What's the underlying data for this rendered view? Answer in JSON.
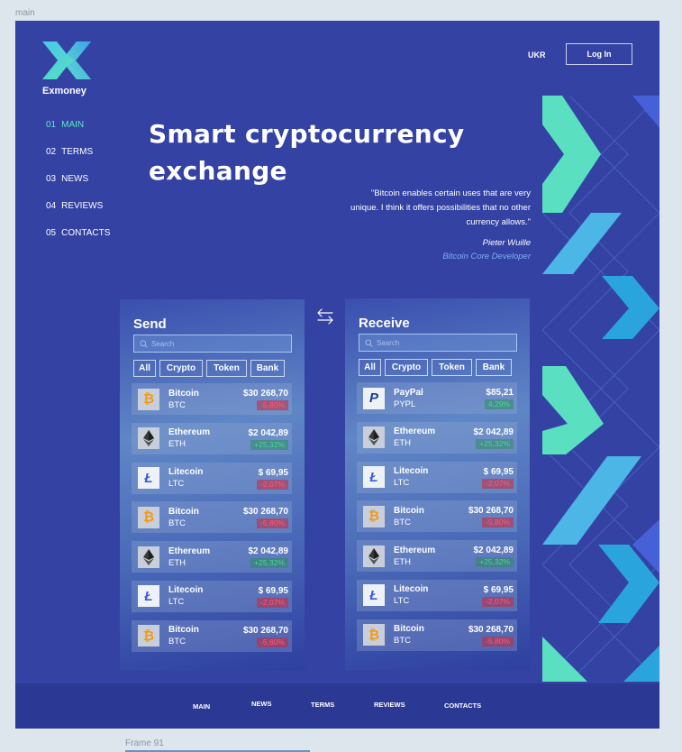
{
  "canvas": {
    "frame_label": "main",
    "next_frame_label": "Frame 91"
  },
  "brand": {
    "name": "Exmoney"
  },
  "header": {
    "lang": "UKR",
    "login_label": "Log In"
  },
  "nav": [
    {
      "num": "01",
      "label": "MAIN"
    },
    {
      "num": "02",
      "label": "TERMS"
    },
    {
      "num": "03",
      "label": "NEWS"
    },
    {
      "num": "04",
      "label": "REVIEWS"
    },
    {
      "num": "05",
      "label": "CONTACTS"
    }
  ],
  "hero": {
    "title_line1": "Smart cryptocurrency",
    "title_line2": "exchange",
    "quote_line1": "\"Bitcoin enables certain uses that are very",
    "quote_line2": "unique. I think it offers possibilities that no other",
    "quote_line3": "currency allows.\"",
    "author": "Pieter Wuille",
    "role": "Bitcoin Core Developer"
  },
  "send": {
    "title": "Send",
    "search_placeholder": "Search",
    "filters": [
      "All",
      "Crypto",
      "Token",
      "Bank"
    ],
    "rows": [
      {
        "name": "Bitcoin",
        "symbol": "BTC",
        "price": "$30 268,70",
        "change": "-5,80%",
        "dir": "neg",
        "icon": "btc"
      },
      {
        "name": "Ethereum",
        "symbol": "ETH",
        "price": "$2 042,89",
        "change": "+25,32%",
        "dir": "pos",
        "icon": "eth"
      },
      {
        "name": "Litecoin",
        "symbol": "LTC",
        "price": "$ 69,95",
        "change": "-2,07%",
        "dir": "neg",
        "icon": "ltc"
      },
      {
        "name": "Bitcoin",
        "symbol": "BTC",
        "price": "$30 268,70",
        "change": "-5,80%",
        "dir": "neg",
        "icon": "btc"
      },
      {
        "name": "Ethereum",
        "symbol": "ETH",
        "price": "$2 042,89",
        "change": "+25,32%",
        "dir": "pos",
        "icon": "eth"
      },
      {
        "name": "Litecoin",
        "symbol": "LTC",
        "price": "$ 69,95",
        "change": "-2,07%",
        "dir": "neg",
        "icon": "ltc"
      },
      {
        "name": "Bitcoin",
        "symbol": "BTC",
        "price": "$30 268,70",
        "change": "-5,80%",
        "dir": "neg",
        "icon": "btc"
      }
    ]
  },
  "receive": {
    "title": "Receive",
    "search_placeholder": "Search",
    "filters": [
      "All",
      "Crypto",
      "Token",
      "Bank"
    ],
    "rows": [
      {
        "name": "PayPal",
        "symbol": "PYPL",
        "price": "$85,21",
        "change": "4,29%",
        "dir": "pos",
        "icon": "pp"
      },
      {
        "name": "Ethereum",
        "symbol": "ETH",
        "price": "$2 042,89",
        "change": "+25,32%",
        "dir": "pos",
        "icon": "eth"
      },
      {
        "name": "Litecoin",
        "symbol": "LTC",
        "price": "$ 69,95",
        "change": "-2,07%",
        "dir": "neg",
        "icon": "ltc"
      },
      {
        "name": "Bitcoin",
        "symbol": "BTC",
        "price": "$30 268,70",
        "change": "-5,80%",
        "dir": "neg",
        "icon": "btc"
      },
      {
        "name": "Ethereum",
        "symbol": "ETH",
        "price": "$2 042,89",
        "change": "+25,32%",
        "dir": "pos",
        "icon": "eth"
      },
      {
        "name": "Litecoin",
        "symbol": "LTC",
        "price": "$ 69,95",
        "change": "-2,07%",
        "dir": "neg",
        "icon": "ltc"
      },
      {
        "name": "Bitcoin",
        "symbol": "BTC",
        "price": "$30 268,70",
        "change": "-5,80%",
        "dir": "neg",
        "icon": "btc"
      }
    ]
  },
  "footer": {
    "links": [
      "MAIN",
      "NEWS",
      "TERMS",
      "REVIEWS",
      "CONTACTS"
    ]
  },
  "colors": {
    "background": "#3342a3",
    "accent": "#5ee8c4",
    "negative": "#ff5a6e",
    "positive": "#47d88e"
  }
}
